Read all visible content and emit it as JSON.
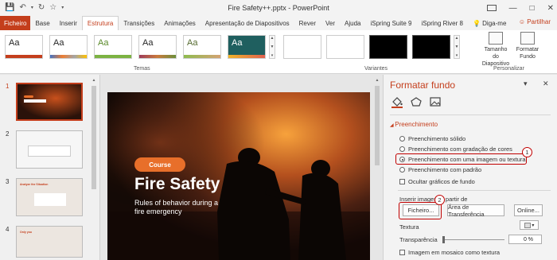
{
  "titlebar": {
    "title": "Fire Safety++.pptx  -  PowerPoint",
    "qat": {
      "save": "save-icon",
      "undo": "undo-icon",
      "redo": "redo-icon"
    }
  },
  "tabs": [
    "Ficheiro",
    "Base",
    "Inserir",
    "Estrutura",
    "Transições",
    "Animações",
    "Apresentação de Diapositivos",
    "Rever",
    "Ver",
    "Ajuda",
    "iSpring Suite 9",
    "iSpring River 8"
  ],
  "tell_me": "Diga-me",
  "share": "Partilhar",
  "ribbon": {
    "themes_label": "Temas",
    "variants_label": "Variantes",
    "customize_label": "Personalizar",
    "theme_glyph": "Aa",
    "slide_size": "Tamanho do Diapositivo",
    "format_bg": "Formatar Fundo"
  },
  "thumbnails": {
    "numbers": [
      "1",
      "2",
      "3",
      "4"
    ],
    "slide3_title": "Analyze the Situation",
    "slide4_title": "Only you"
  },
  "slide": {
    "badge": "Course",
    "title": "Fire Safety",
    "subtitle": "Rules of behavior during a fire emergency"
  },
  "pane": {
    "title": "Formatar fundo",
    "section": "Preenchimento",
    "fills": [
      "Preenchimento sólido",
      "Preenchimento com gradação de cores",
      "Preenchimento com uma imagem ou textura",
      "Preenchimento com padrão"
    ],
    "hide_graphics": "Ocultar gráficos de fundo",
    "insert_image_from": "Inserir imagem a partir de",
    "btn_file": "Ficheiro...",
    "btn_clipboard": "Área de Transferência",
    "btn_online": "Online...",
    "texture": "Textura",
    "transparency": "Transparência",
    "transparency_value": "0 %",
    "tile": "Imagem em mosaico como textura",
    "callout1": "1",
    "callout2": "2"
  }
}
